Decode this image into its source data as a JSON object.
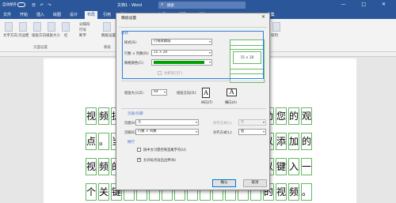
{
  "titlebar": {
    "autosave": "自动保存",
    "qat": "日 ↶ ↷",
    "doc_title": "文档1 - Word",
    "search_placeholder": "搜索",
    "window_controls": "— □ ✕"
  },
  "tabs": [
    "文件",
    "开始",
    "插入",
    "绘图",
    "设计",
    "布局",
    "引用",
    "邮件",
    "审阅",
    "视图",
    "帮助",
    "PDF工具集"
  ],
  "ribbon": {
    "group_labels": [
      "页面设置",
      "稿纸"
    ],
    "items": {
      "text_direction": "文字方向",
      "margins": "页边距",
      "orientation": "纸张方向",
      "size": "纸张大小",
      "columns": "栏",
      "breaks": "分隔符",
      "line_numbers": "行号",
      "hyphenation": "断字",
      "manuscript": "稿纸设置",
      "arrange": "排列"
    }
  },
  "dialog": {
    "title": "稿纸设置",
    "close": "✕",
    "section_format": "格式",
    "style_label": "样式(S):",
    "style_value": "行线式稿纸",
    "rows_cols_label": "行数 × 列数(R):",
    "rows_cols_value": "15 × 20",
    "grid_color_label": "网格颜色(C):",
    "grid_color": "#00a000",
    "diagonal_label": "对折装订(F)",
    "preview_text": "15 × 20",
    "paper_size_label": "纸张大小(Z):",
    "paper_size_value": "A4",
    "orientation_label": "纸张方向(O):",
    "portrait_label": "纵向(T)",
    "landscape_label": "横向(A)",
    "section_header_footer": "页眉/页脚",
    "header_label": "页眉(H):",
    "header_value": "无",
    "footer_label": "页脚(E):",
    "footer_value": "行数 × 列数",
    "align_label": "对齐方式(L):",
    "align_value_top": "右",
    "align_value_bottom": "右",
    "section_wrap": "换行",
    "wrap_option1": "按中文习惯控制首尾字符(U)",
    "wrap_option2": "允许标点溢出边界(N)",
    "ok": "确认",
    "cancel": "取消"
  },
  "document": {
    "rows": [
      [
        "视",
        "频",
        "提",
        "",
        "",
        "",
        "",
        "",
        "",
        "",
        "",
        "",
        "",
        "",
        "助",
        "您",
        "的",
        "观"
      ],
      [
        "点",
        "。",
        "当",
        "",
        "",
        "",
        "",
        "",
        "",
        "",
        "",
        "",
        "",
        "",
        "以",
        "添",
        "加",
        "的"
      ],
      [
        "视",
        "频",
        "的",
        "",
        "",
        "",
        "",
        "",
        "",
        "",
        "",
        "",
        "",
        "",
        "以",
        "键",
        "入",
        "一"
      ],
      [
        "个",
        "关",
        "键",
        "",
        "",
        "",
        "",
        "",
        "",
        "",
        "",
        "",
        "",
        "",
        "的",
        "视",
        "频",
        "。"
      ]
    ]
  }
}
